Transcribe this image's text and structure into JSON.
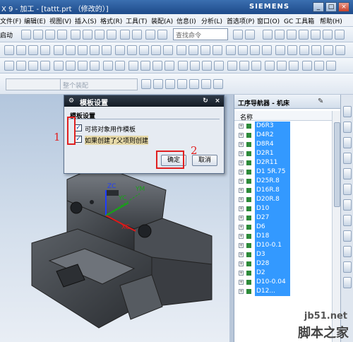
{
  "window": {
    "title": "X 9 - 加工 - [tattt.prt （修改的）]",
    "brand": "SIEMENS"
  },
  "menu": [
    "文件(F)",
    "编辑(E)",
    "视图(V)",
    "插入(S)",
    "格式(R)",
    "工具(T)",
    "装配(A)",
    "信息(I)",
    "分析(L)",
    "首选项(P)",
    "窗口(O)",
    "GC 工具箱",
    "帮助(H)"
  ],
  "toolbar": {
    "start_label": "启动",
    "command_search_placeholder": "查找命令",
    "filter_placeholder": "整个装配"
  },
  "dialog": {
    "title": "模板设置",
    "group": "模板设置",
    "options": [
      {
        "label": "可将对象用作模板",
        "checked": true
      },
      {
        "label": "如果创建了父项则创建",
        "checked": true
      }
    ],
    "ok": "确定",
    "cancel": "取消"
  },
  "annotations": {
    "marker1": "1",
    "marker2": "2"
  },
  "axes": {
    "zc": "ZC",
    "yc": "YC",
    "ym": "YM",
    "xc": "XC"
  },
  "navigator": {
    "title": "工序导航器 - 机床",
    "column": "名称",
    "items": [
      "D6R3",
      "D4R2",
      "D8R4",
      "D2R1",
      "D2R11",
      "D1 5R.75",
      "D25R.8",
      "D16R.8",
      "D20R.8",
      "D10",
      "D27",
      "D6",
      "D18",
      "D10-0.1",
      "D3",
      "D28",
      "D2",
      "D10-0.04",
      "D12..."
    ]
  },
  "watermark": {
    "site": "jb51.net",
    "name": "脚本之家"
  },
  "colors": {
    "selection": "#3399ff",
    "annotation": "#e02020",
    "titlebar": "#1d4a8a"
  }
}
